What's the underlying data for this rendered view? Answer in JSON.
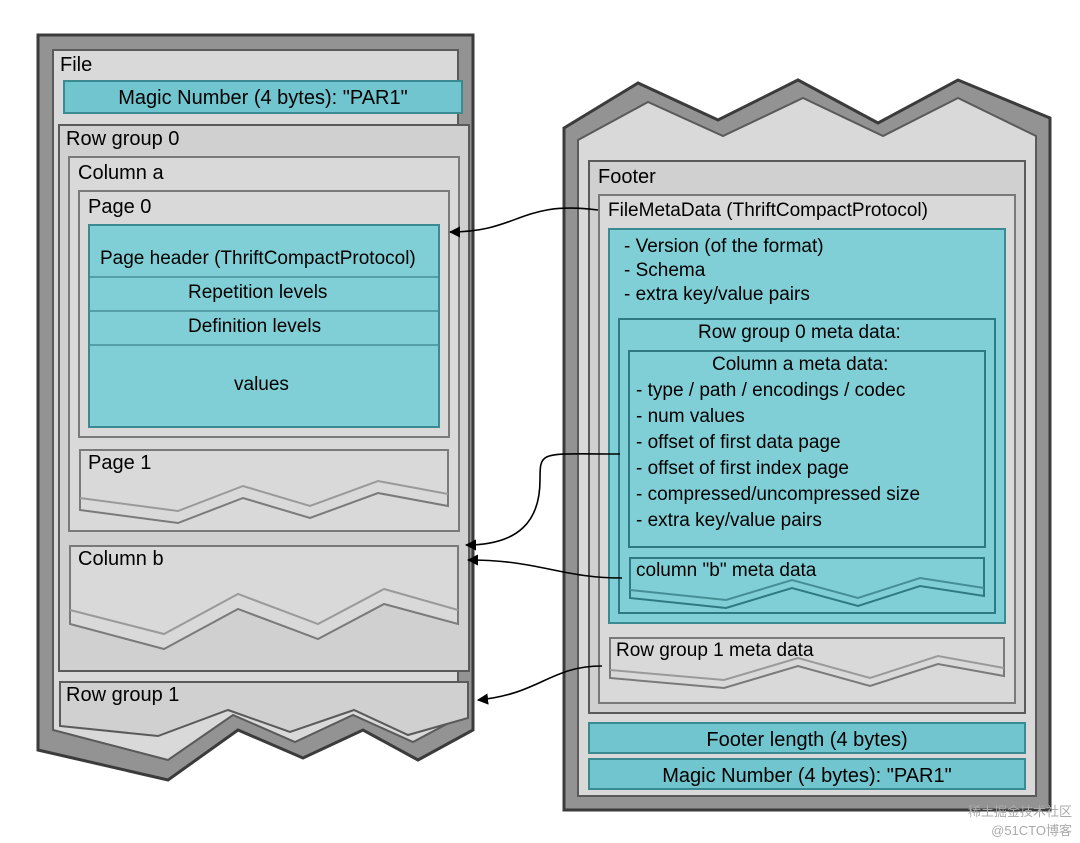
{
  "file": {
    "title": "File",
    "magic": "Magic Number (4 bytes): \"PAR1\"",
    "rowgroup0": {
      "title": "Row group 0",
      "columnA": {
        "title": "Column a",
        "page0": {
          "title": "Page 0",
          "header": "Page header (ThriftCompactProtocol)",
          "rep": "Repetition levels",
          "def": "Definition levels",
          "values": "values"
        },
        "page1": {
          "title": "Page 1"
        }
      },
      "columnB": {
        "title": "Column b"
      }
    },
    "rowgroup1": {
      "title": "Row group 1"
    }
  },
  "footer": {
    "title": "Footer",
    "filemeta": {
      "title": "FileMetaData (ThriftCompactProtocol)",
      "version": "- Version (of the format)",
      "schema": "- Schema",
      "extra": "- extra key/value pairs",
      "rg0": {
        "title": "Row group 0 meta data:",
        "colA": {
          "title": "Column a meta data:",
          "l1": "- type / path / encodings / codec",
          "l2": "- num values",
          "l3": "- offset of first data page",
          "l4": "- offset of first index page",
          "l5": "- compressed/uncompressed size",
          "l6": "- extra key/value pairs"
        },
        "colB": "column \"b\" meta data"
      },
      "rg1": "Row group 1 meta data"
    },
    "length": "Footer length (4 bytes)",
    "magic": "Magic Number (4 bytes): \"PAR1\""
  },
  "watermark": {
    "l1": "稀土掘金技术社区",
    "l2": "@51CTO博客"
  }
}
